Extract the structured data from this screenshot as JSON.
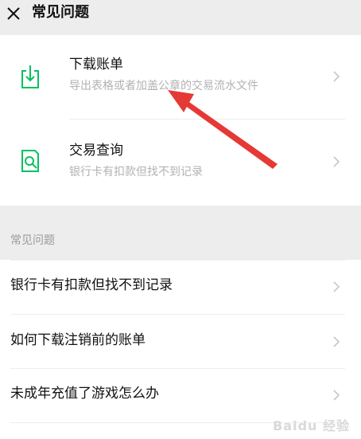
{
  "header": {
    "title": "常见问题",
    "close_icon": "close-icon"
  },
  "top_entries": [
    {
      "title": "下载账单",
      "subtitle": "导出表格或者加盖公章的交易流水文件",
      "icon": "download-icon"
    },
    {
      "title": "交易查询",
      "subtitle": "银行卡有扣款但找不到记录",
      "icon": "search-document-icon"
    }
  ],
  "section_label": "常见问题",
  "faq_items": [
    {
      "label": "银行卡有扣款但找不到记录"
    },
    {
      "label": "如何下载注销前的账单"
    },
    {
      "label": "未成年充值了游戏怎么办"
    }
  ],
  "watermark": "Baidu 经验",
  "colors": {
    "accent_green": "#07c160",
    "arrow_red": "#e53935",
    "background": "#ededed"
  }
}
